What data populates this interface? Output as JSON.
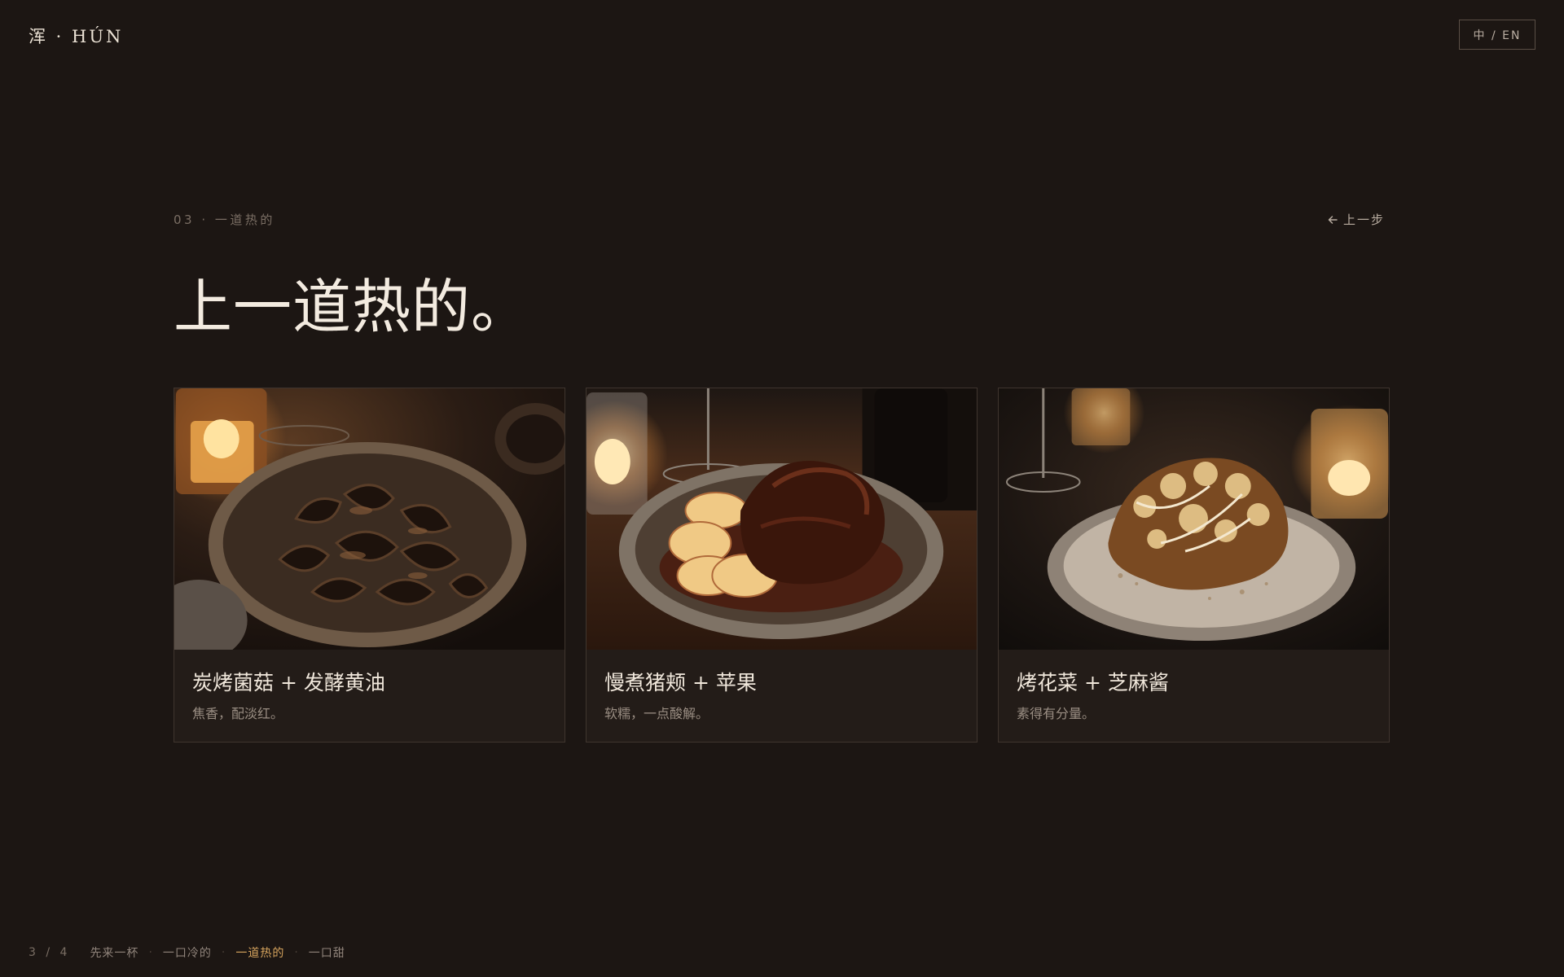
{
  "header": {
    "brand": "浑 · HÚN",
    "lang_toggle": "中 / EN"
  },
  "section": {
    "eyebrow": "03 · 一道热的",
    "back_label": "上一步",
    "title": "上一道热的。"
  },
  "cards": [
    {
      "name": "炭烤菌菇 + 发酵黄油",
      "desc": "焦香，配淡红。"
    },
    {
      "name": "慢煮猪颊 + 苹果",
      "desc": "软糯，一点酸解。"
    },
    {
      "name": "烤花菜 + 芝麻酱",
      "desc": "素得有分量。"
    }
  ],
  "progress": {
    "count": "3 / 4",
    "steps": [
      "先来一杯",
      "一口冷的",
      "一道热的",
      "一口甜"
    ],
    "active_index": 2
  },
  "colors": {
    "background": "#1c1613",
    "accent": "#d6a45e"
  }
}
